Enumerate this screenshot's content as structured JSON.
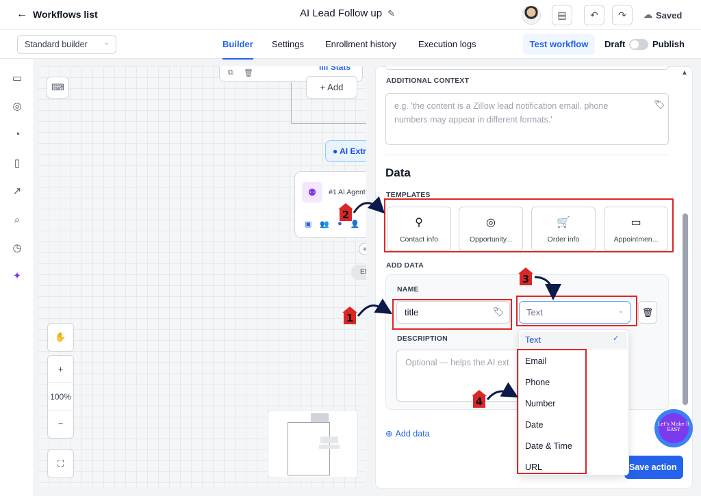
{
  "topbar": {
    "back_label": "Workflows list",
    "workflow_title": "AI Lead Follow up",
    "saved_label": "Saved"
  },
  "subbar": {
    "builder_select": "Standard builder",
    "tabs": [
      {
        "label": "Builder",
        "active": true
      },
      {
        "label": "Settings",
        "active": false
      },
      {
        "label": "Enrollment history",
        "active": false
      },
      {
        "label": "Execution logs",
        "active": false
      }
    ],
    "test_workflow": "Test workflow",
    "draft_label": "Draft",
    "publish_label": "Publish"
  },
  "canvas": {
    "stats_label": "Stats",
    "add_label": "Add",
    "ai_pill_label": "AI Extr",
    "agent_label": "#1 AI Agent",
    "end_label": "EN",
    "zoom_level": "100%",
    "zoom_in": "+",
    "zoom_out": "−"
  },
  "panel": {
    "additional_context_label": "ADDITIONAL CONTEXT",
    "additional_context_placeholder": "e.g. 'the content is a Zillow lead notification email. phone numbers may appear in different formats.'",
    "data_title": "Data",
    "templates_label": "TEMPLATES",
    "templates": [
      {
        "label": "Contact info",
        "icon": "person-icon"
      },
      {
        "label": "Opportunity...",
        "icon": "target-icon"
      },
      {
        "label": "Order info",
        "icon": "cart-icon"
      },
      {
        "label": "Appointmen...",
        "icon": "ticket-icon"
      }
    ],
    "add_data_label": "ADD DATA",
    "name_label": "NAME",
    "name_value": "title",
    "type_value": "Text",
    "description_label": "DESCRIPTION",
    "description_placeholder": "Optional — helps the AI ext",
    "type_options": [
      "Text",
      "Email",
      "Phone",
      "Number",
      "Date",
      "Date & Time",
      "URL"
    ],
    "selected_type": "Text",
    "add_data_link": "Add data",
    "save_action": "Save action"
  },
  "badge_text": "Let's Make It EASY",
  "annotations": {
    "steps": [
      "1",
      "2",
      "3",
      "4"
    ],
    "color": "#dc2626"
  }
}
